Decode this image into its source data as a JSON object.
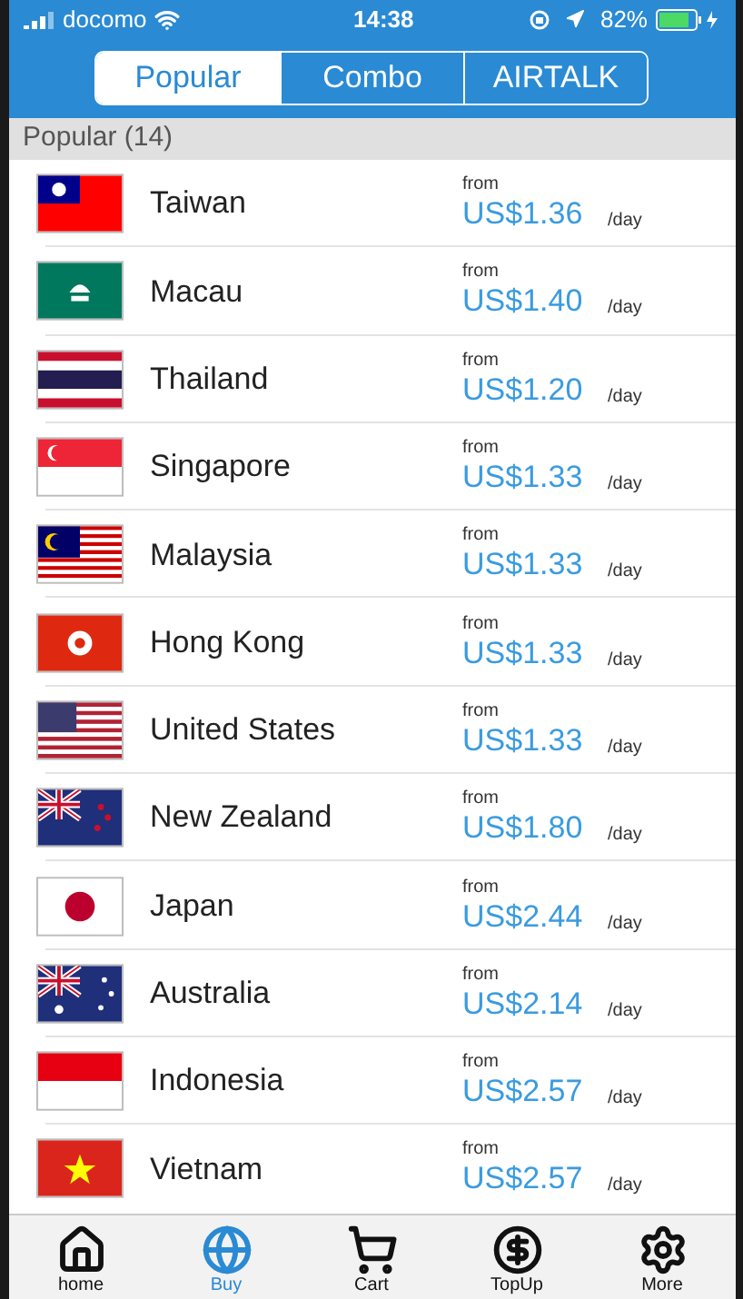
{
  "status_bar": {
    "carrier": "docomo",
    "time": "14:38",
    "battery": "82%"
  },
  "tabs": [
    {
      "label": "Popular",
      "selected": true
    },
    {
      "label": "Combo",
      "selected": false
    },
    {
      "label": "AIRTALK",
      "selected": false
    }
  ],
  "section": {
    "title": "Popular (14)"
  },
  "rows": [
    {
      "country": "Taiwan",
      "from": "from",
      "price": "US$1.36",
      "unit": "/day"
    },
    {
      "country": "Macau",
      "from": "from",
      "price": "US$1.40",
      "unit": "/day"
    },
    {
      "country": "Thailand",
      "from": "from",
      "price": "US$1.20",
      "unit": "/day"
    },
    {
      "country": "Singapore",
      "from": "from",
      "price": "US$1.33",
      "unit": "/day"
    },
    {
      "country": "Malaysia",
      "from": "from",
      "price": "US$1.33",
      "unit": "/day"
    },
    {
      "country": "Hong Kong",
      "from": "from",
      "price": "US$1.33",
      "unit": "/day"
    },
    {
      "country": "United States",
      "from": "from",
      "price": "US$1.33",
      "unit": "/day"
    },
    {
      "country": "New Zealand",
      "from": "from",
      "price": "US$1.80",
      "unit": "/day"
    },
    {
      "country": "Japan",
      "from": "from",
      "price": "US$2.44",
      "unit": "/day"
    },
    {
      "country": "Australia",
      "from": "from",
      "price": "US$2.14",
      "unit": "/day"
    },
    {
      "country": "Indonesia",
      "from": "from",
      "price": "US$2.57",
      "unit": "/day"
    },
    {
      "country": "Vietnam",
      "from": "from",
      "price": "US$2.57",
      "unit": "/day"
    }
  ],
  "nav": [
    {
      "label": "home",
      "selected": false
    },
    {
      "label": "Buy",
      "selected": true
    },
    {
      "label": "Cart",
      "selected": false
    },
    {
      "label": "TopUp",
      "selected": false
    },
    {
      "label": "More",
      "selected": false
    }
  ]
}
